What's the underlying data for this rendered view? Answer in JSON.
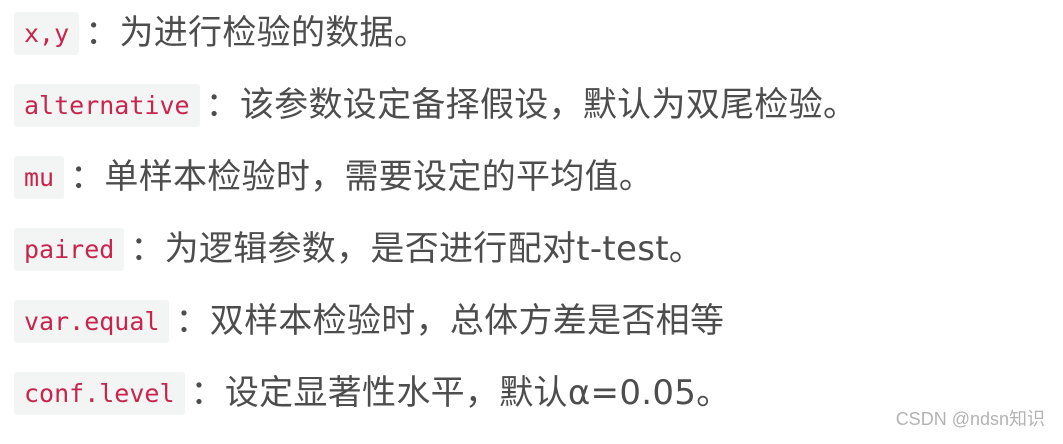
{
  "params": [
    {
      "code": "x,y",
      "desc": "：为进行检验的数据。"
    },
    {
      "code": "alternative",
      "desc": "：该参数设定备择假设，默认为双尾检验。"
    },
    {
      "code": "mu",
      "desc": "：单样本检验时，需要设定的平均值。"
    },
    {
      "code": "paired",
      "desc": "：为逻辑参数，是否进行配对t-test。"
    },
    {
      "code": "var.equal",
      "desc": "：双样本检验时，总体方差是否相等"
    },
    {
      "code": "conf.level",
      "desc": "：设定显著性水平，默认α=0.05。"
    }
  ],
  "watermark": "CSDN @ndsn知识",
  "colors": {
    "code_text": "#c7254e",
    "code_background": "#f3f4f4",
    "body_text": "#4d4d4d",
    "watermark": "#b3b3b3"
  }
}
